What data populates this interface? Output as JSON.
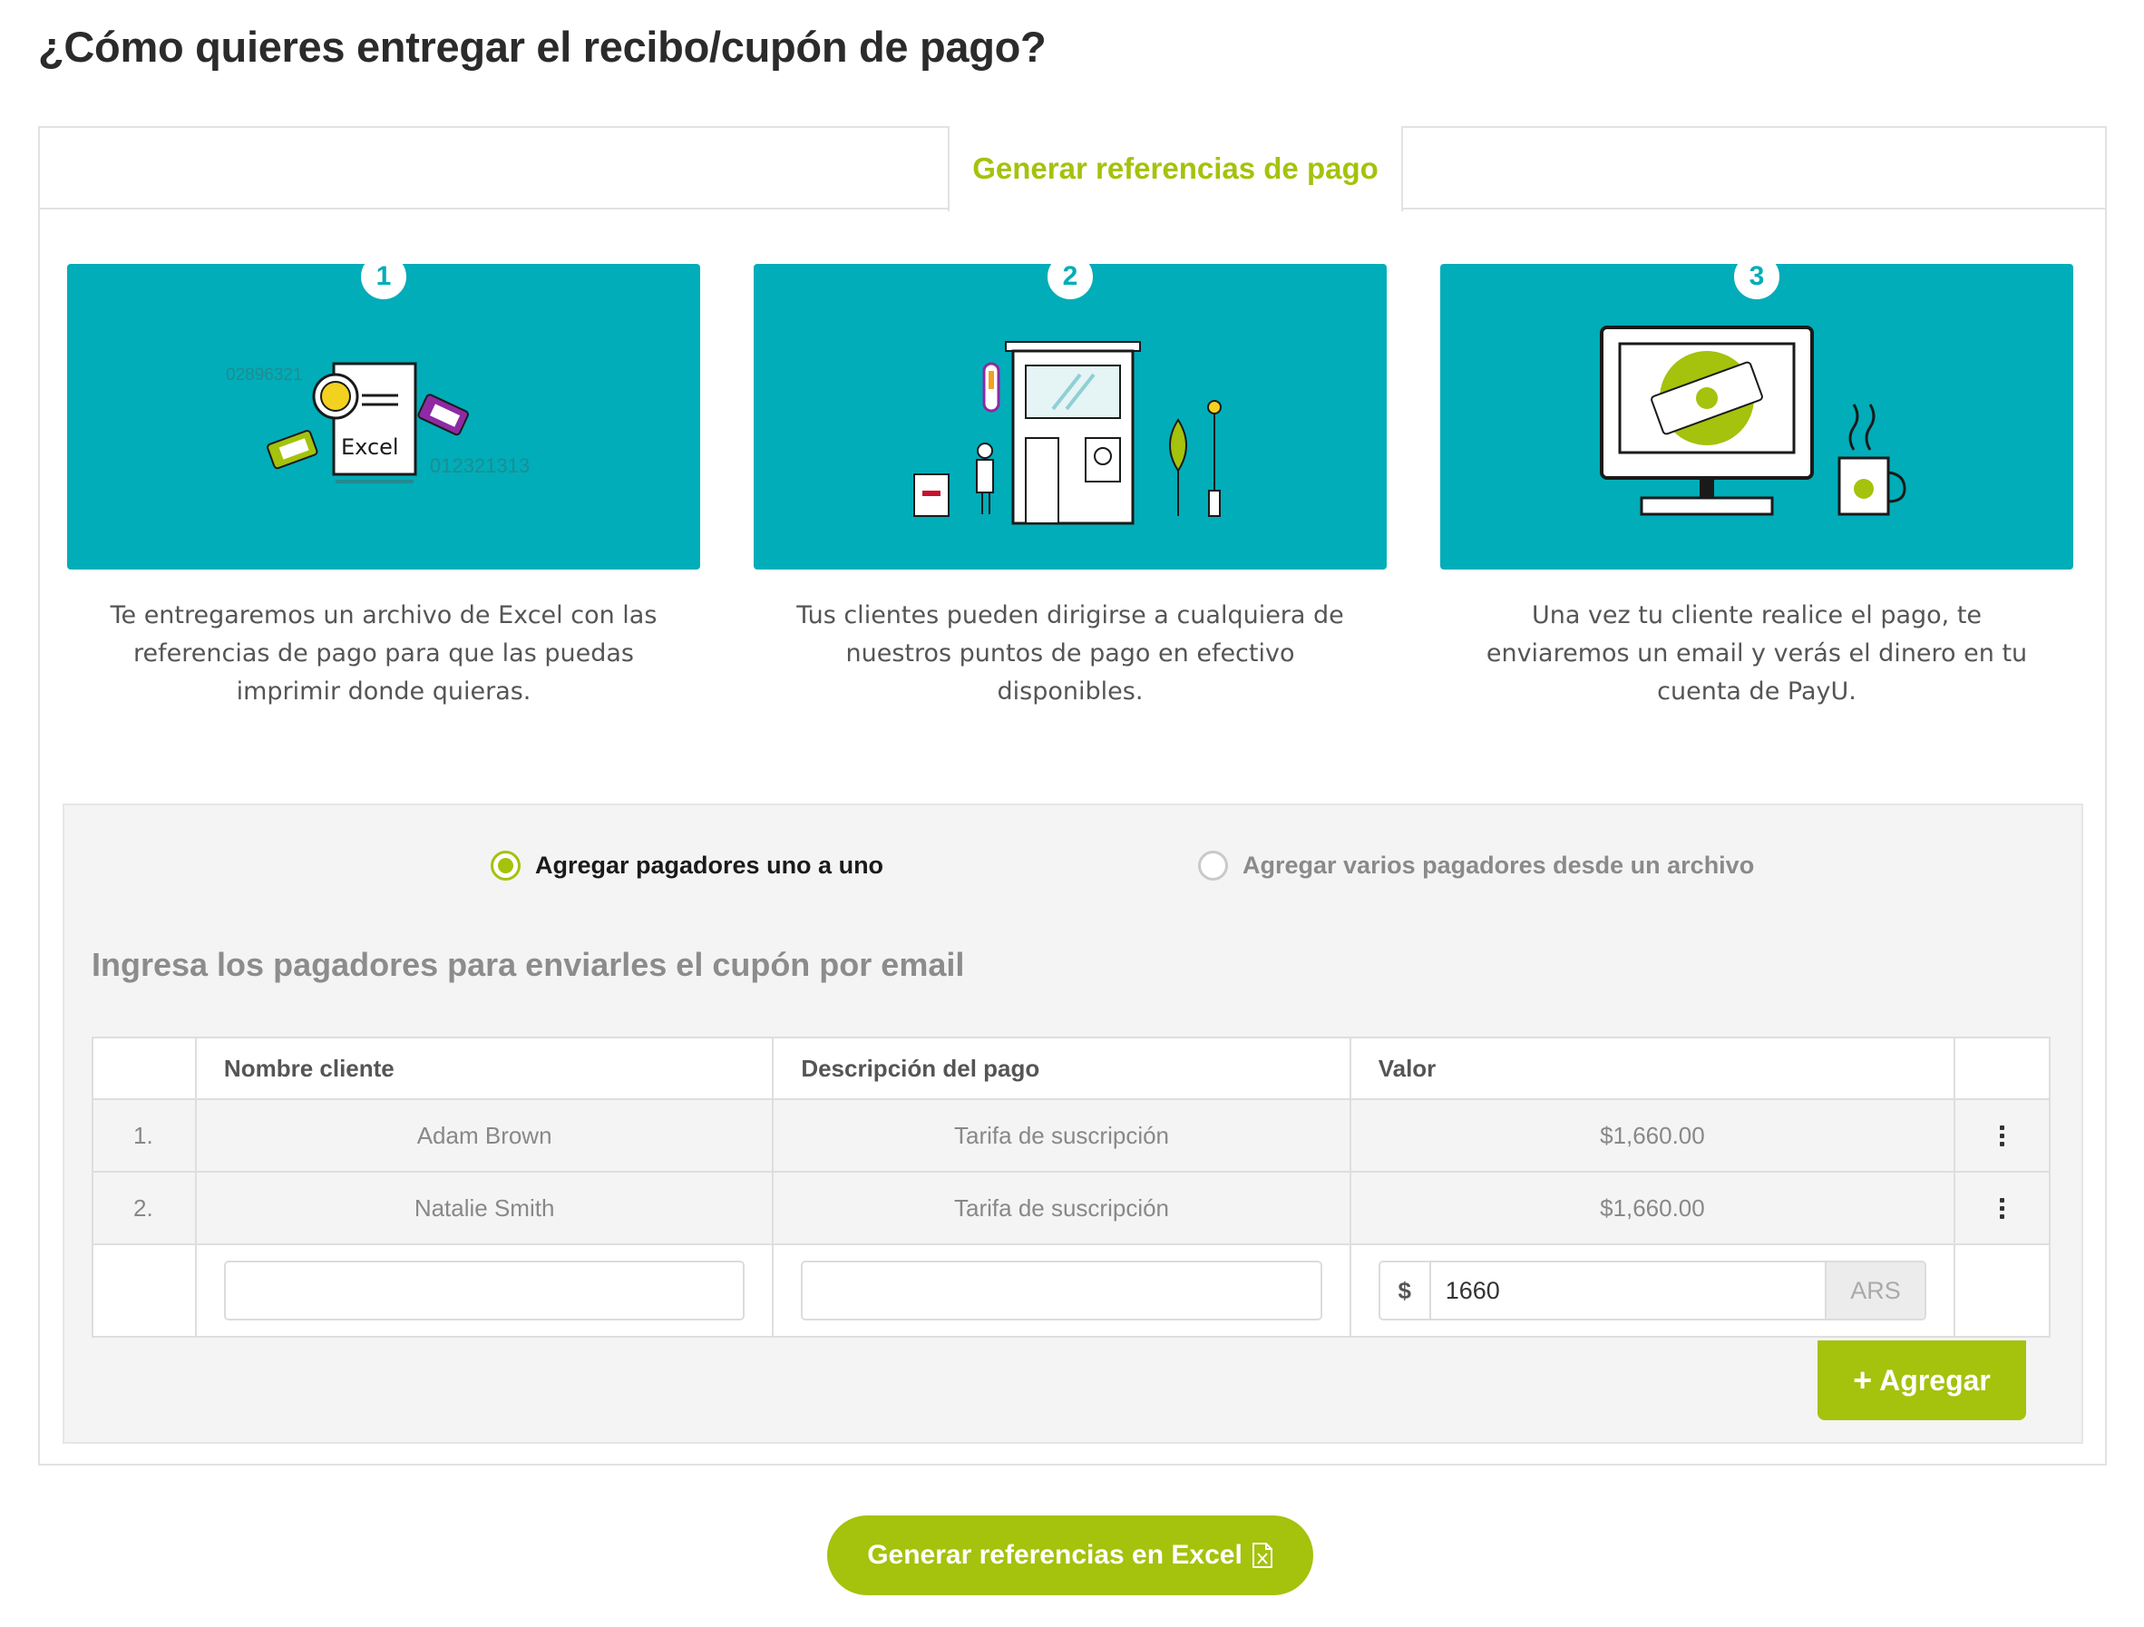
{
  "page": {
    "title": "¿Cómo quieres entregar el recibo/cupón de pago?"
  },
  "tabs": {
    "active_label": "Generar referencias de pago"
  },
  "steps": [
    {
      "number": "1",
      "text": "Te entregaremos un archivo de Excel con las referencias de pago para que las puedas imprimir donde quieras.",
      "art_labels": {
        "code_top": "02896321",
        "file": "Excel",
        "code_bottom": "012321313"
      }
    },
    {
      "number": "2",
      "text": "Tus clientes pueden dirigirse a cualquiera de nuestros puntos de pago en efectivo disponibles."
    },
    {
      "number": "3",
      "text": "Una vez tu cliente realice el pago, te enviaremos un email y verás el dinero en tu cuenta de PayU."
    }
  ],
  "payer_mode": {
    "options": [
      {
        "label": "Agregar pagadores uno a uno",
        "selected": true
      },
      {
        "label": "Agregar varios pagadores desde un archivo",
        "selected": false
      }
    ]
  },
  "form": {
    "heading": "Ingresa los pagadores para enviarles el cupón por email",
    "columns": [
      "",
      "Nombre cliente",
      "Descripción del pago",
      "Valor",
      ""
    ],
    "rows": [
      {
        "index": "1.",
        "name": "Adam Brown",
        "description": "Tarifa de suscripción",
        "value": "$1,660.00"
      },
      {
        "index": "2.",
        "name": "Natalie Smith",
        "description": "Tarifa de suscripción",
        "value": "$1,660.00"
      }
    ],
    "new_row": {
      "name": "",
      "description": "",
      "currency_symbol": "$",
      "amount": "1660",
      "currency": "ARS"
    },
    "add_button": "Agregar"
  },
  "actions": {
    "generate_excel": "Generar referencias en Excel"
  },
  "colors": {
    "brand_green": "#a5c20c",
    "teal": "#00adb8",
    "panel_bg": "#f4f4f4"
  },
  "icons": [
    "plus-icon",
    "excel-file-icon",
    "kebab-menu-icon",
    "radio-selected-icon",
    "radio-unselected-icon"
  ]
}
